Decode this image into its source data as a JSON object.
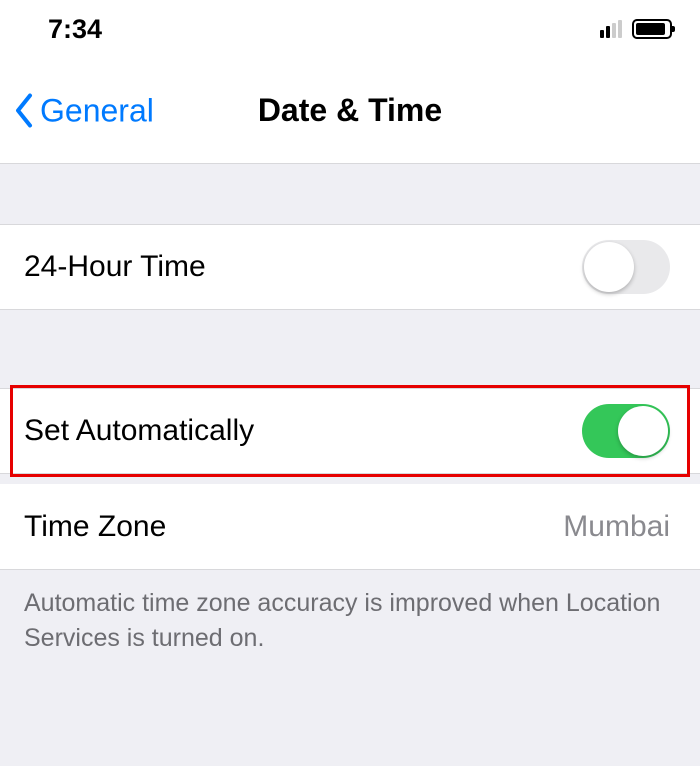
{
  "status_bar": {
    "time": "7:34"
  },
  "nav": {
    "back_label": "General",
    "title": "Date & Time"
  },
  "rows": {
    "twenty_four_hour": {
      "label": "24-Hour Time",
      "enabled": false
    },
    "set_automatically": {
      "label": "Set Automatically",
      "enabled": true,
      "highlighted": true
    },
    "time_zone": {
      "label": "Time Zone",
      "value": "Mumbai"
    }
  },
  "footer": {
    "note": "Automatic time zone accuracy is improved when Location Services is turned on."
  }
}
